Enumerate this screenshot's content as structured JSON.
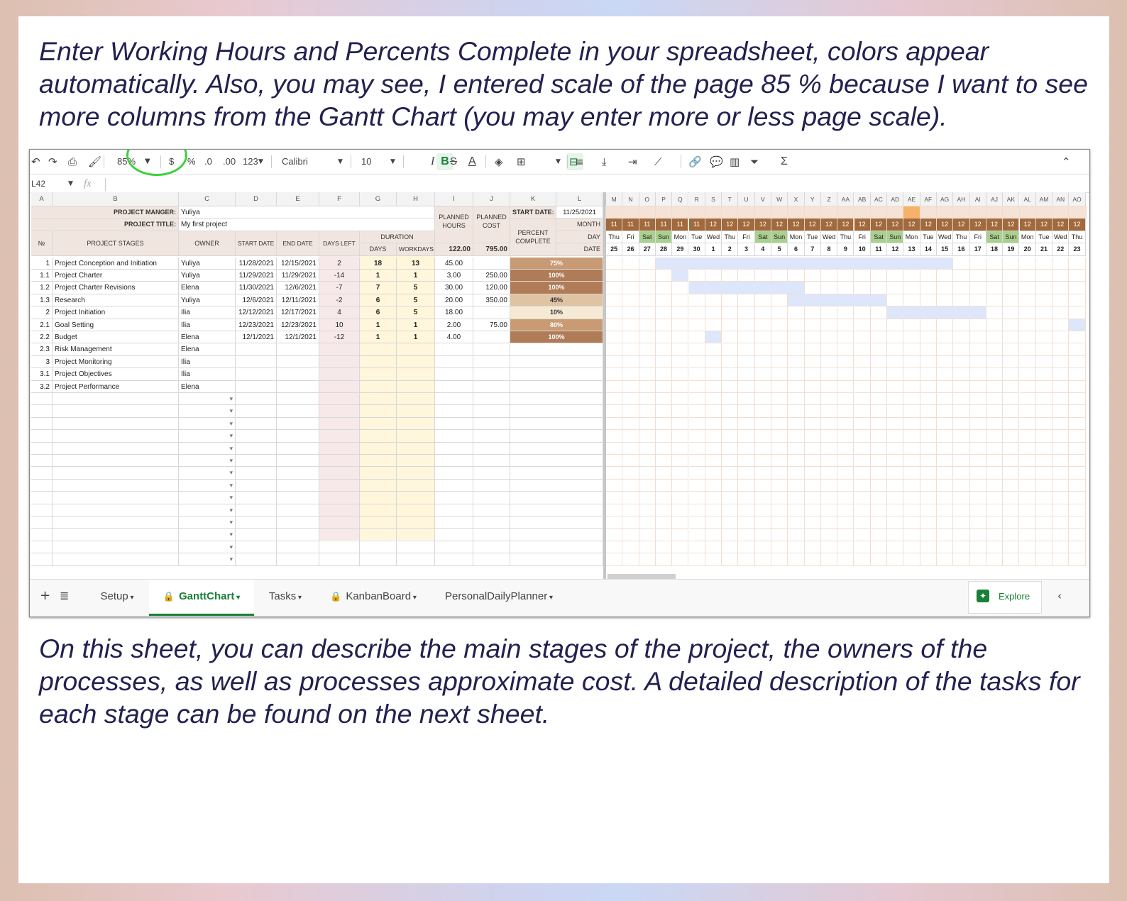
{
  "captions": {
    "top": "Enter Working Hours and Percents Complete in your spreadsheet, colors appear automatically. Also, you may see, I entered scale of the page 85 % because I want to see more columns from the Gantt Chart (you may enter more or less page scale).",
    "bottom": "On this sheet, you can describe the main stages of the project, the owners of the processes, as well as processes approximate cost. A detailed description of the tasks for each stage can be found on the next sheet."
  },
  "toolbar": {
    "zoom": "85%",
    "currency": "$",
    "percent": "%",
    "dec_decrease": ".0",
    "dec_increase": ".00",
    "number_format": "123",
    "font": "Calibri",
    "font_size": "10",
    "bold": "B",
    "italic": "I",
    "strike": "S",
    "text_color": "A",
    "sigma": "Σ"
  },
  "formula_bar": {
    "cell_ref": "L42",
    "fx": "fx"
  },
  "columns": [
    "A",
    "B",
    "C",
    "D",
    "E",
    "F",
    "G",
    "H",
    "I",
    "J",
    "K",
    "L"
  ],
  "gantt_columns": [
    "M",
    "N",
    "O",
    "P",
    "Q",
    "R",
    "S",
    "T",
    "U",
    "V",
    "W",
    "X",
    "Y",
    "Z",
    "AA",
    "AB",
    "AC",
    "AD",
    "AE",
    "AF",
    "AG",
    "AH",
    "AI",
    "AJ",
    "AK",
    "AL",
    "AM",
    "AN",
    "AO"
  ],
  "project": {
    "manager_label": "PROJECT MANGER:",
    "manager": "Yuliya",
    "title_label": "PROJECT TITLE:",
    "title": "My first project",
    "start_label": "START DATE:",
    "start_date": "11/25/2021"
  },
  "headers": {
    "no": "№",
    "stages": "PROJECT STAGES",
    "owner": "OWNER",
    "start": "START DATE",
    "end": "END DATE",
    "days_left": "DAYS LEFT",
    "duration": "DURATION",
    "days": "DAYS",
    "workdays": "WORKDAYS",
    "planned_hours": "PLANNED HOURS",
    "planned_cost": "PLANNED COST",
    "percent": "PERCENT COMPLETE",
    "month": "MONTH",
    "day": "DAY",
    "date": "DATE",
    "total_hours": "122.00",
    "total_cost": "795.00"
  },
  "rows": [
    {
      "no": "1",
      "stage": "Project Conception and Initiation",
      "owner": "Yuliya",
      "start": "11/28/2021",
      "end": "12/15/2021",
      "left": "2",
      "days": "18",
      "work": "13",
      "hours": "45.00",
      "cost": "",
      "pct": "75%"
    },
    {
      "no": "1.1",
      "stage": "Project Charter",
      "owner": "Yuliya",
      "start": "11/29/2021",
      "end": "11/29/2021",
      "left": "-14",
      "days": "1",
      "work": "1",
      "hours": "3.00",
      "cost": "250.00",
      "pct": "100%"
    },
    {
      "no": "1.2",
      "stage": "Project Charter Revisions",
      "owner": "Elena",
      "start": "11/30/2021",
      "end": "12/6/2021",
      "left": "-7",
      "days": "7",
      "work": "5",
      "hours": "30.00",
      "cost": "120.00",
      "pct": "100%"
    },
    {
      "no": "1.3",
      "stage": "Research",
      "owner": "Yuliya",
      "start": "12/6/2021",
      "end": "12/11/2021",
      "left": "-2",
      "days": "6",
      "work": "5",
      "hours": "20.00",
      "cost": "350.00",
      "pct": "45%"
    },
    {
      "no": "2",
      "stage": "Project Initiation",
      "owner": "Ilia",
      "start": "12/12/2021",
      "end": "12/17/2021",
      "left": "4",
      "days": "6",
      "work": "5",
      "hours": "18.00",
      "cost": "",
      "pct": "10%"
    },
    {
      "no": "2.1",
      "stage": "Goal Setting",
      "owner": "Ilia",
      "start": "12/23/2021",
      "end": "12/23/2021",
      "left": "10",
      "days": "1",
      "work": "1",
      "hours": "2.00",
      "cost": "75.00",
      "pct": "80%"
    },
    {
      "no": "2.2",
      "stage": "Budget",
      "owner": "Elena",
      "start": "12/1/2021",
      "end": "12/1/2021",
      "left": "-12",
      "days": "1",
      "work": "1",
      "hours": "4.00",
      "cost": "",
      "pct": "100%"
    },
    {
      "no": "2.3",
      "stage": "Risk Management",
      "owner": "Elena",
      "start": "",
      "end": "",
      "left": "",
      "days": "",
      "work": "",
      "hours": "",
      "cost": "",
      "pct": ""
    },
    {
      "no": "3",
      "stage": "Project Monitoring",
      "owner": "Ilia",
      "start": "",
      "end": "",
      "left": "",
      "days": "",
      "work": "",
      "hours": "",
      "cost": "",
      "pct": ""
    },
    {
      "no": "3.1",
      "stage": "Project Objectives",
      "owner": "Ilia",
      "start": "",
      "end": "",
      "left": "",
      "days": "",
      "work": "",
      "hours": "",
      "cost": "",
      "pct": ""
    },
    {
      "no": "3.2",
      "stage": "Project Performance",
      "owner": "Elena",
      "start": "",
      "end": "",
      "left": "",
      "days": "",
      "work": "",
      "hours": "",
      "cost": "",
      "pct": ""
    }
  ],
  "timeline": {
    "months": [
      "11",
      "11",
      "11",
      "11",
      "11",
      "11",
      "12",
      "12",
      "12",
      "12",
      "12",
      "12",
      "12",
      "12",
      "12",
      "12",
      "12",
      "12",
      "12",
      "12",
      "12",
      "12",
      "12",
      "12",
      "12",
      "12",
      "12",
      "12",
      "12"
    ],
    "days": [
      "Thu",
      "Fri",
      "Sat",
      "Sun",
      "Mon",
      "Tue",
      "Wed",
      "Thu",
      "Fri",
      "Sat",
      "Sun",
      "Mon",
      "Tue",
      "Wed",
      "Thu",
      "Fri",
      "Sat",
      "Sun",
      "Mon",
      "Tue",
      "Wed",
      "Thu",
      "Fri",
      "Sat",
      "Sun",
      "Mon",
      "Tue",
      "Wed",
      "Thu"
    ],
    "dates": [
      "25",
      "26",
      "27",
      "28",
      "29",
      "30",
      "1",
      "2",
      "3",
      "4",
      "5",
      "6",
      "7",
      "8",
      "9",
      "10",
      "11",
      "12",
      "13",
      "14",
      "15",
      "16",
      "17",
      "18",
      "19",
      "20",
      "21",
      "22",
      "23"
    ]
  },
  "gantt_bars": [
    {
      "row": 0,
      "start": 3,
      "len": 18
    },
    {
      "row": 1,
      "start": 4,
      "len": 1
    },
    {
      "row": 2,
      "start": 5,
      "len": 7
    },
    {
      "row": 3,
      "start": 11,
      "len": 6
    },
    {
      "row": 4,
      "start": 17,
      "len": 6
    },
    {
      "row": 5,
      "start": 28,
      "len": 1
    },
    {
      "row": 6,
      "start": 6,
      "len": 1
    }
  ],
  "today_col": 18,
  "colors": {
    "bar": "#dde6fb",
    "weekend": "#a9d08e",
    "month_bg": "#a26a3c",
    "pct_full": "#b07b57",
    "pct_mid": "#c99b74",
    "pct_low": "#dfc3a3",
    "pct_min": "#f6ead4",
    "today": "#f6b26b"
  },
  "sheet_tabs": [
    "Setup",
    "GanttChart",
    "Tasks",
    "KanbanBoard",
    "PersonalDailyPlanner"
  ],
  "active_tab": "GanttChart",
  "explore_label": "Explore"
}
